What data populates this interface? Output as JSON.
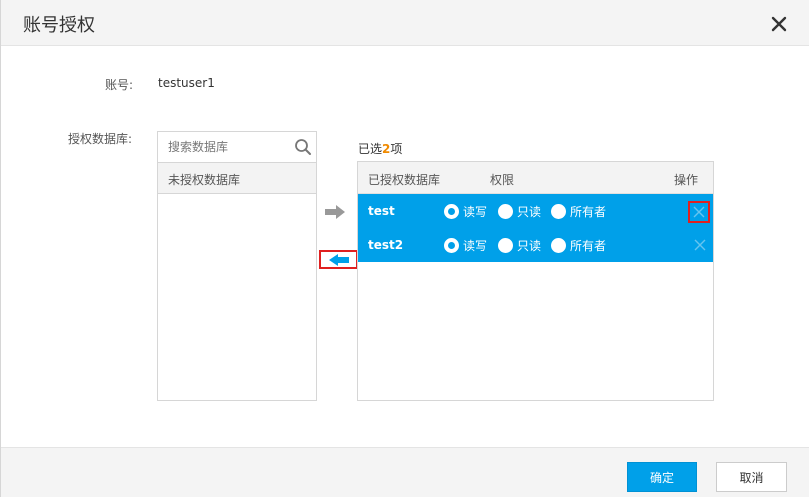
{
  "dialog": {
    "title": "账号授权",
    "close_icon": "close-icon"
  },
  "form": {
    "account_label": "账号:",
    "account_value": "testuser1",
    "db_label": "授权数据库:"
  },
  "left_panel": {
    "search_placeholder": "搜索数据库",
    "search_icon": "search-icon",
    "header": "未授权数据库"
  },
  "transfer": {
    "right_arrow_icon": "arrow-right-icon",
    "left_arrow_icon": "arrow-left-icon"
  },
  "selected": {
    "prefix": "已选",
    "count": "2",
    "suffix": "项",
    "columns": {
      "db": "已授权数据库",
      "permission": "权限",
      "action": "操作"
    },
    "permission_options": [
      "读写",
      "只读",
      "所有者"
    ],
    "rows": [
      {
        "name": "test",
        "selected_permission": "读写"
      },
      {
        "name": "test2",
        "selected_permission": "读写"
      }
    ]
  },
  "footer": {
    "ok_label": "确定",
    "cancel_label": "取消"
  },
  "colors": {
    "accent": "#00a0e9",
    "highlight_border": "#e02020",
    "count_color": "#f08a00"
  }
}
